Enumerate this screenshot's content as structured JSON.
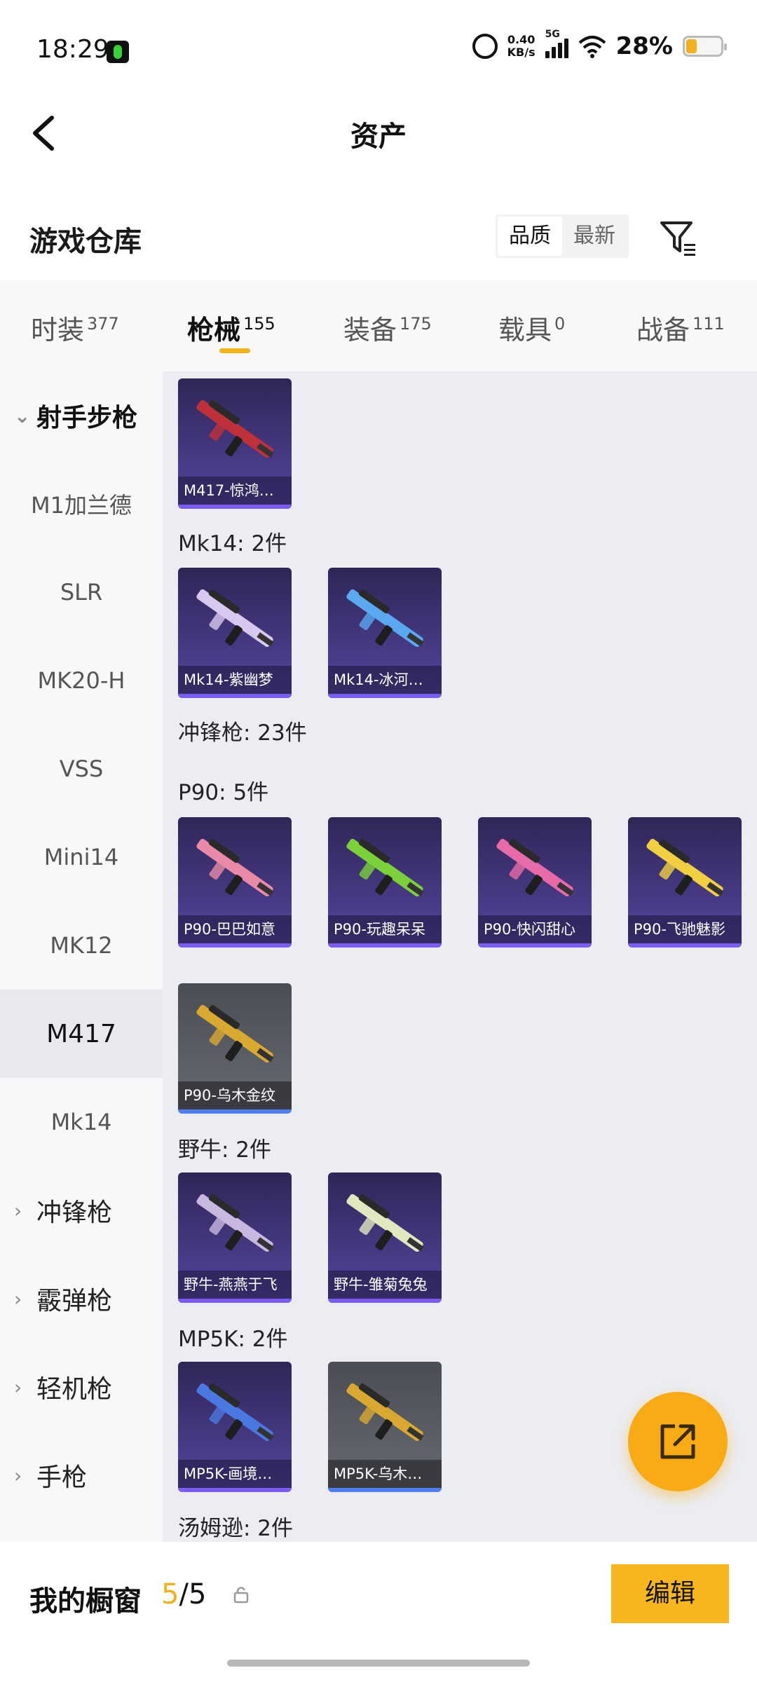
{
  "status_bar": {
    "time": "18:29",
    "speed_value": "0.40",
    "speed_unit": "KB/s",
    "network": "5G",
    "battery_pct": "28%",
    "battery_level": 0.28
  },
  "header": {
    "title": "资产"
  },
  "warehouse": {
    "title": "游戏仓库",
    "sort_options": [
      "品质",
      "最新"
    ],
    "sort_selected": "品质"
  },
  "tabs": [
    {
      "label": "时装",
      "count": "377"
    },
    {
      "label": "枪械",
      "count": "155",
      "active": true
    },
    {
      "label": "装备",
      "count": "175"
    },
    {
      "label": "载具",
      "count": "0"
    },
    {
      "label": "战备",
      "count": "111"
    }
  ],
  "sidebar": {
    "items": [
      {
        "label": "射手步枪",
        "type": "category",
        "expanded": true
      },
      {
        "label": "M1加兰德"
      },
      {
        "label": "SLR"
      },
      {
        "label": "MK20-H"
      },
      {
        "label": "VSS"
      },
      {
        "label": "Mini14"
      },
      {
        "label": "MK12"
      },
      {
        "label": "M417",
        "active": true
      },
      {
        "label": "Mk14"
      },
      {
        "label": "冲锋枪",
        "type": "category"
      },
      {
        "label": "霰弹枪",
        "type": "category"
      },
      {
        "label": "轻机枪",
        "type": "category"
      },
      {
        "label": "手枪",
        "type": "category"
      }
    ]
  },
  "content": {
    "sections": [
      {
        "label": "Mk14: 2件"
      },
      {
        "label": "冲锋枪: 23件"
      },
      {
        "label": "P90: 5件"
      },
      {
        "label": "野牛: 2件"
      },
      {
        "label": "MP5K: 2件"
      },
      {
        "label": "汤姆逊: 2件"
      }
    ],
    "cards": [
      {
        "name": "M417-惊鸿…",
        "rarity": "purple",
        "accent": "#c0303a"
      },
      {
        "name": "Mk14-紫幽梦",
        "rarity": "purple",
        "accent": "#d8c8f0"
      },
      {
        "name": "Mk14-冰河…",
        "rarity": "purple",
        "accent": "#5aa8f0"
      },
      {
        "name": "P90-巴巴如意",
        "rarity": "purple",
        "accent": "#e88aa8"
      },
      {
        "name": "P90-玩趣呆呆",
        "rarity": "purple",
        "accent": "#7ad13a"
      },
      {
        "name": "P90-快闪甜心",
        "rarity": "purple",
        "accent": "#e86aa8"
      },
      {
        "name": "P90-飞驰魅影",
        "rarity": "purple",
        "accent": "#f0d040"
      },
      {
        "name": "P90-乌木金纹",
        "rarity": "gray",
        "accent": "#d8a830"
      },
      {
        "name": "野牛-燕燕于飞",
        "rarity": "purple",
        "accent": "#c8b8e0"
      },
      {
        "name": "野牛-雏菊兔兔",
        "rarity": "purple",
        "accent": "#e0e8c0"
      },
      {
        "name": "MP5K-画境…",
        "rarity": "purple",
        "accent": "#4a78e0"
      },
      {
        "name": "MP5K-乌木…",
        "rarity": "gray",
        "accent": "#d8a830"
      }
    ]
  },
  "bottom": {
    "label": "我的橱窗",
    "current": "5",
    "separator": "/",
    "total": "5",
    "edit_label": "编辑"
  },
  "colors": {
    "accent": "#f7b61d",
    "purple_rarity": "#4a3c8a",
    "gray_rarity": "#5f6269"
  }
}
